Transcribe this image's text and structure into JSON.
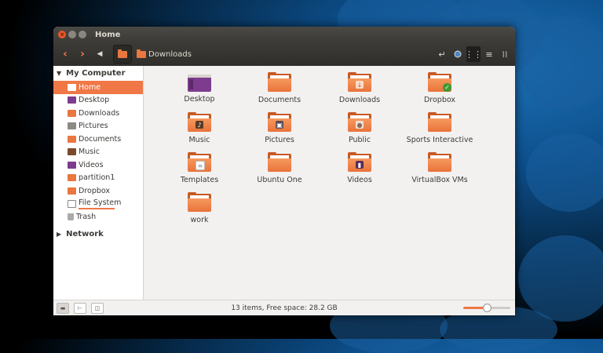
{
  "window": {
    "title": "Home"
  },
  "toolbar": {
    "back_icon": "‹",
    "forward_icon": "›",
    "toggle_icon": "◀",
    "breadcrumb": "Downloads"
  },
  "sidebar": {
    "my_computer": "My Computer",
    "network": "Network",
    "items": [
      {
        "label": "Home",
        "icon": "home-folder-icon"
      },
      {
        "label": "Desktop",
        "icon": "desktop-folder-icon"
      },
      {
        "label": "Downloads",
        "icon": "downloads-folder-icon"
      },
      {
        "label": "Pictures",
        "icon": "pictures-folder-icon"
      },
      {
        "label": "Documents",
        "icon": "documents-folder-icon"
      },
      {
        "label": "Music",
        "icon": "music-folder-icon"
      },
      {
        "label": "Videos",
        "icon": "videos-folder-icon"
      },
      {
        "label": "partition1",
        "icon": "drive-icon"
      },
      {
        "label": "Dropbox",
        "icon": "dropbox-folder-icon"
      },
      {
        "label": "File System",
        "icon": "filesystem-icon"
      },
      {
        "label": "Trash",
        "icon": "trash-icon"
      }
    ]
  },
  "files": [
    {
      "name": "Desktop"
    },
    {
      "name": "Documents"
    },
    {
      "name": "Downloads"
    },
    {
      "name": "Dropbox"
    },
    {
      "name": "Music"
    },
    {
      "name": "Pictures"
    },
    {
      "name": "Public"
    },
    {
      "name": "Sports Interactive"
    },
    {
      "name": "Templates"
    },
    {
      "name": "Ubuntu One"
    },
    {
      "name": "Videos"
    },
    {
      "name": "VirtualBox VMs"
    },
    {
      "name": "work"
    }
  ],
  "status": {
    "text": "13 items, Free space: 28.2 GB",
    "zoom_level": 0.5
  },
  "colors": {
    "accent": "#f07746",
    "titlebar": "#3c3b37"
  }
}
